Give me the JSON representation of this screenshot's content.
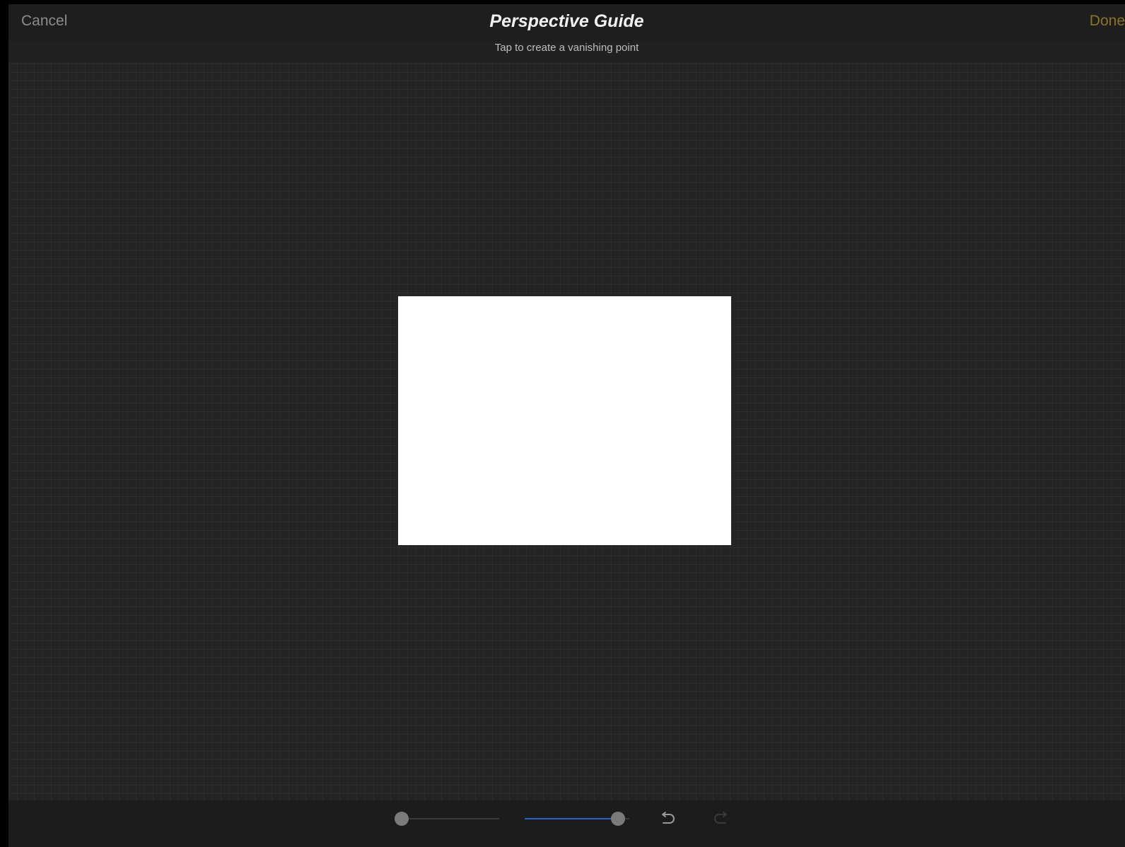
{
  "header": {
    "cancel_label": "Cancel",
    "title": "Perspective Guide",
    "done_label": "Done",
    "hint": "Tap to create a vanishing point"
  },
  "toolbar": {
    "opacity_slider": {
      "value": 0.0
    },
    "thickness_slider": {
      "value": 0.95
    },
    "undo_icon": "undo-icon",
    "redo_icon": "redo-icon"
  },
  "colors": {
    "accent": "#8a7424",
    "slider_fill": "#2f63c8",
    "background": "#242424",
    "canvas": "#ffffff"
  }
}
